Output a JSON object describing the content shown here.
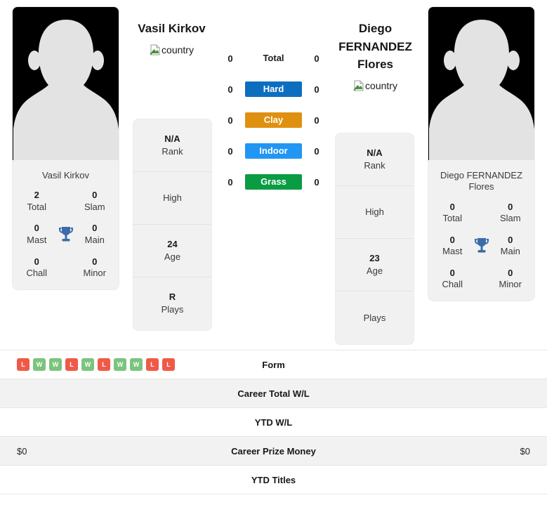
{
  "players": {
    "left": {
      "name": "Vasil Kirkov",
      "photo_caption": "Vasil Kirkov",
      "country_alt": "country",
      "trophies": [
        {
          "num": "2",
          "label": "Total"
        },
        {
          "num": "0",
          "label": "Slam"
        },
        {
          "num": "0",
          "label": "Mast"
        },
        {
          "num": "0",
          "label": "Main"
        },
        {
          "num": "0",
          "label": "Chall"
        },
        {
          "num": "0",
          "label": "Minor"
        }
      ],
      "info": [
        {
          "value": "N/A",
          "label": "Rank"
        },
        {
          "value": "",
          "label": "High"
        },
        {
          "value": "24",
          "label": "Age"
        },
        {
          "value": "R",
          "label": "Plays"
        }
      ]
    },
    "right": {
      "name": "Diego FERNANDEZ Flores",
      "photo_caption": "Diego FERNANDEZ Flores",
      "country_alt": "country",
      "trophies": [
        {
          "num": "0",
          "label": "Total"
        },
        {
          "num": "0",
          "label": "Slam"
        },
        {
          "num": "0",
          "label": "Mast"
        },
        {
          "num": "0",
          "label": "Main"
        },
        {
          "num": "0",
          "label": "Chall"
        },
        {
          "num": "0",
          "label": "Minor"
        }
      ],
      "info": [
        {
          "value": "N/A",
          "label": "Rank"
        },
        {
          "value": "",
          "label": "High"
        },
        {
          "value": "23",
          "label": "Age"
        },
        {
          "value": "",
          "label": "Plays"
        }
      ]
    }
  },
  "h2h": {
    "rows": [
      {
        "label": "Total",
        "left": "0",
        "right": "0",
        "color": "",
        "style": "plain"
      },
      {
        "label": "Hard",
        "left": "0",
        "right": "0",
        "color": "#0d6ec0",
        "style": "tinted"
      },
      {
        "label": "Clay",
        "left": "0",
        "right": "0",
        "color": "#e09010",
        "style": "tinted"
      },
      {
        "label": "Indoor",
        "left": "0",
        "right": "0",
        "color": "#2196f3",
        "style": "tinted"
      },
      {
        "label": "Grass",
        "left": "0",
        "right": "0",
        "color": "#099c42",
        "style": "tinted"
      }
    ]
  },
  "stats_table": {
    "rows": [
      {
        "label": "Form",
        "left": "",
        "right": "",
        "alt": false,
        "form": [
          "L",
          "W",
          "W",
          "L",
          "W",
          "L",
          "W",
          "W",
          "L",
          "L"
        ]
      },
      {
        "label": "Career Total W/L",
        "left": "",
        "right": "",
        "alt": true
      },
      {
        "label": "YTD W/L",
        "left": "",
        "right": "",
        "alt": false
      },
      {
        "label": "Career Prize Money",
        "left": "$0",
        "right": "$0",
        "alt": true
      },
      {
        "label": "YTD Titles",
        "left": "",
        "right": "",
        "alt": false
      }
    ]
  },
  "colors": {
    "hard": "#0d6ec0",
    "clay": "#e09010",
    "indoor": "#2196f3",
    "grass": "#099c42",
    "win": "#7bc47f",
    "loss": "#ef5a48",
    "trophy": "#3b6ca8"
  }
}
